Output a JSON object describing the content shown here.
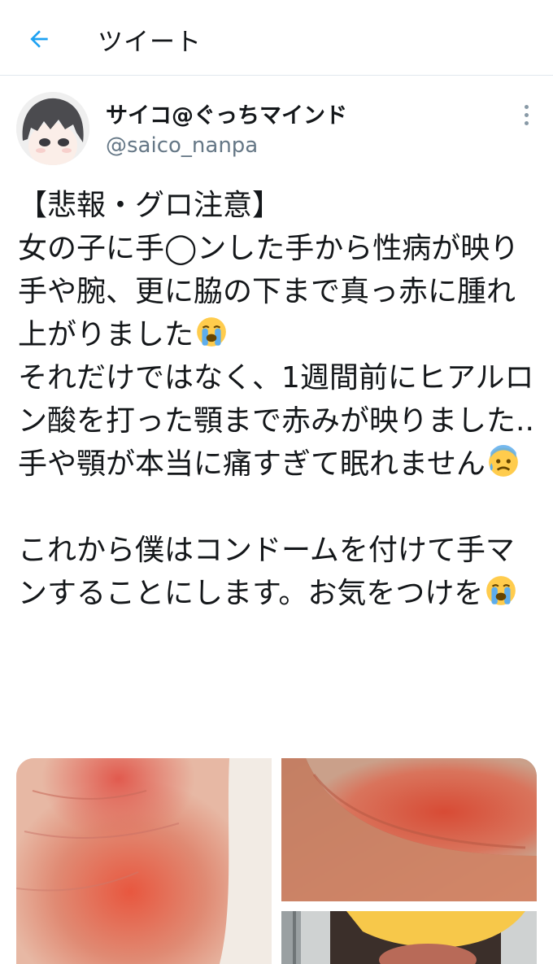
{
  "header": {
    "title": "ツイート"
  },
  "tweet": {
    "author_name": "サイコ@ぐっちマインド",
    "author_handle": "@saico_nanpa",
    "paragraphs": [
      {
        "text": "【悲報・グロ注意】\n女の子に手◯ンした手から性病が映り手や腕、更に脇の下まで真っ赤に腫れ上がりました",
        "emoji": "loudly-crying-face"
      },
      {
        "text": "\nそれだけではなく、1週間前にヒアルロン酸を打った顎まで赤みが映りました..\n手や顎が本当に痛すぎて眠れません",
        "emoji": "anxious-face-with-sweat"
      },
      {
        "text": "\n\nこれから僕はコンドームを付けて手マンすることにします。お気をつけを",
        "emoji": "loudly-crying-face"
      }
    ]
  },
  "icons": {
    "back": "arrow-left-icon",
    "more": "more-vertical-icon"
  },
  "colors": {
    "accent": "#1da1f2",
    "text": "#14171a",
    "secondary": "#657786"
  }
}
